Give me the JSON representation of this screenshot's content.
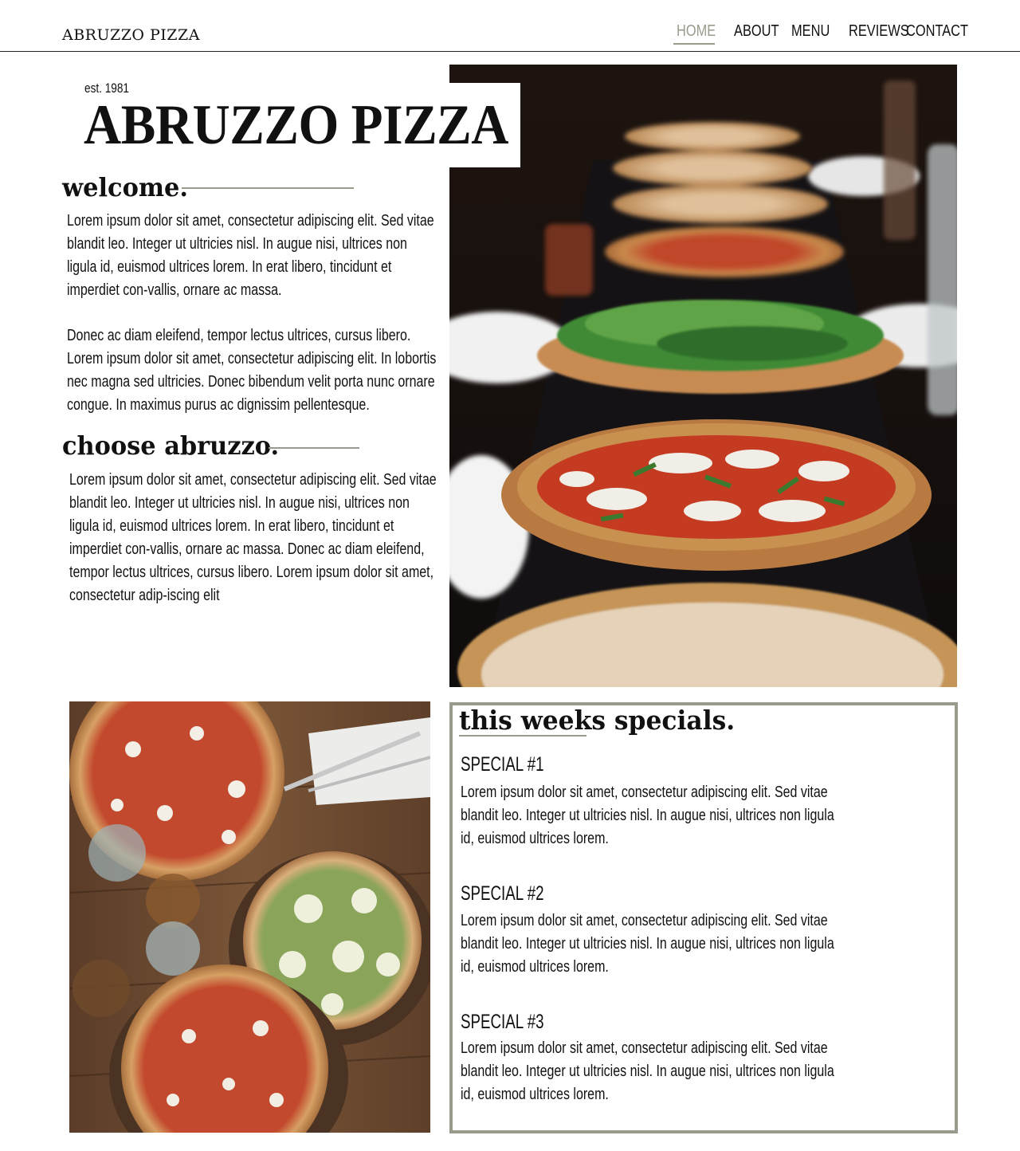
{
  "header": {
    "brand": "ABRUZZO PIZZA",
    "nav": [
      {
        "label": "HOME",
        "active": true
      },
      {
        "label": "ABOUT",
        "active": false
      },
      {
        "label": "MENU",
        "active": false
      },
      {
        "label": "REVIEWS",
        "active": false
      },
      {
        "label": "CONTACT",
        "active": false
      }
    ]
  },
  "hero": {
    "est": "est. 1981",
    "title": "ABRUZZO PIZZA",
    "photo": "pizza-table-photo"
  },
  "welcome": {
    "heading": "welcome.",
    "paragraphs": [
      "Lorem ipsum dolor sit amet, consectetur adipiscing elit. Sed vitae blandit leo. Integer ut ultricies nisl. In augue nisi, ultrices non ligula id, euismod ultrices lorem. In erat libero, tincidunt et imperdiet con-vallis, ornare ac massa.",
      "Donec ac diam eleifend, tempor lectus ultrices, cursus libero. Lorem ipsum dolor sit amet, consectetur adipiscing elit. In lobortis nec magna sed ultricies. Donec bibendum velit porta nunc ornare congue. In maximus purus ac dignissim pellentesque."
    ]
  },
  "choose": {
    "heading": "choose abruzzo.",
    "text": "Lorem ipsum dolor sit amet, consectetur adipiscing elit. Sed vitae blandit leo. Integer ut ultricies nisl. In augue nisi, ultrices non ligula id, euismod ultrices lorem. In erat libero, tincidunt et imperdiet con-vallis, ornare ac massa. Donec ac diam eleifend, tempor lectus ultrices, cursus libero. Lorem ipsum dolor sit amet, consectetur adip-iscing elit"
  },
  "gallery": {
    "photo": "pizzas-overhead-photo"
  },
  "specials": {
    "heading": "this weeks specials.",
    "items": [
      {
        "name": "SPECIAL #1",
        "text": "Lorem ipsum dolor sit amet, consectetur adipiscing elit. Sed vitae blandit leo. Integer ut ultricies nisl. In augue nisi, ultrices non ligula id, euismod ultrices lorem."
      },
      {
        "name": "SPECIAL #2",
        "text": "Lorem ipsum dolor sit amet, consectetur adipiscing elit. Sed vitae blandit leo. Integer ut ultricies nisl. In augue nisi, ultrices non ligula id, euismod ultrices lorem."
      },
      {
        "name": "SPECIAL #3",
        "text": "Lorem ipsum dolor sit amet, consectetur adipiscing elit. Sed vitae blandit leo. Integer ut ultricies nisl. In augue nisi, ultrices non ligula id, euismod ultrices lorem."
      }
    ]
  },
  "colors": {
    "accent": "#9a9a8c",
    "text": "#111111",
    "background": "#ffffff"
  }
}
